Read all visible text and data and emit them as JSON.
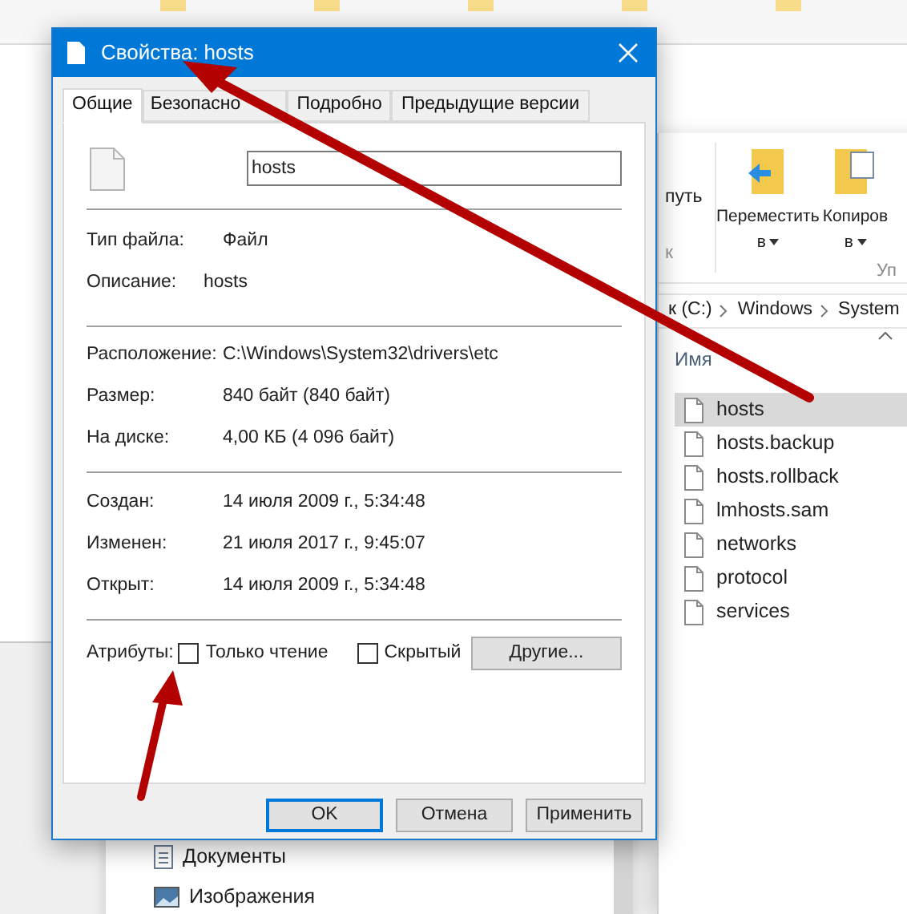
{
  "bookmarks": [
    {
      "kind": "folder"
    },
    {
      "kind": "folder"
    },
    {
      "kind": "folder"
    },
    {
      "kind": "folder"
    },
    {
      "kind": "folder"
    }
  ],
  "explorer": {
    "ribbon_fragments": [
      "путь",
      "к"
    ],
    "ribbon_buttons": [
      {
        "label": "Переместить",
        "caret": "в",
        "kind": "move"
      },
      {
        "label": "Копиров",
        "caret": "в",
        "kind": "copy"
      }
    ],
    "group_label": "Уп",
    "breadcrumb": [
      "к (C:)",
      "Windows",
      "System"
    ],
    "column_header": "Имя",
    "files": [
      {
        "name": "hosts",
        "selected": true
      },
      {
        "name": "hosts.backup",
        "selected": false
      },
      {
        "name": "hosts.rollback",
        "selected": false
      },
      {
        "name": "lmhosts.sam",
        "selected": false
      },
      {
        "name": "networks",
        "selected": false
      },
      {
        "name": "protocol",
        "selected": false
      },
      {
        "name": "services",
        "selected": false
      }
    ]
  },
  "nav_pane": {
    "items": [
      {
        "label": "Документы",
        "kind": "documents"
      },
      {
        "label": "Изображения",
        "kind": "pictures"
      }
    ]
  },
  "dialog": {
    "title": "Свойства: hosts",
    "tabs": [
      {
        "label": "Общие",
        "selected": true
      },
      {
        "label": "Безопасно",
        "selected": false
      },
      {
        "label": "Подробно",
        "selected": false
      },
      {
        "label": "Предыдущие версии",
        "selected": false
      }
    ],
    "file_name": "hosts",
    "sections": [
      [
        {
          "label": "Тип файла:",
          "value": "Файл"
        },
        {
          "label": "Описание:",
          "value": "hosts"
        }
      ],
      [
        {
          "label": "Расположение:",
          "value": "C:\\Windows\\System32\\drivers\\etc"
        },
        {
          "label": "Размер:",
          "value": "840 байт (840 байт)"
        },
        {
          "label": "На диске:",
          "value": "4,00 КБ (4 096 байт)"
        }
      ],
      [
        {
          "label": "Создан:",
          "value": "14 июля 2009 г., 5:34:48"
        },
        {
          "label": "Изменен:",
          "value": "21 июля 2017 г., 9:45:07"
        },
        {
          "label": "Открыт:",
          "value": "14 июля 2009 г., 5:34:48"
        }
      ]
    ],
    "attributes": {
      "label": "Атрибуты:",
      "checkboxes": [
        {
          "label": "Только чтение",
          "checked": false
        },
        {
          "label": "Скрытый",
          "checked": false
        }
      ],
      "advanced_button": "Другие..."
    },
    "buttons": [
      {
        "label": "OK",
        "default": true
      },
      {
        "label": "Отмена",
        "default": false
      },
      {
        "label": "Применить",
        "default": false
      }
    ]
  }
}
